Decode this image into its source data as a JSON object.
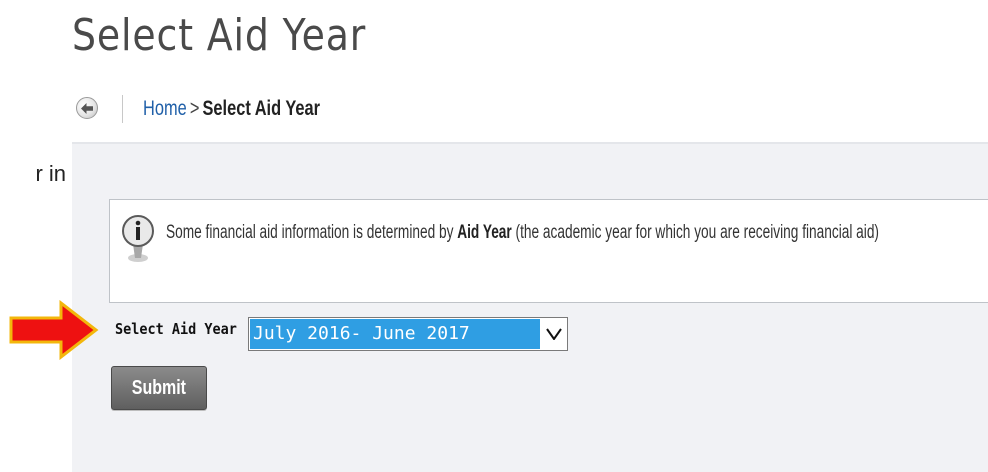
{
  "page": {
    "title": "Select Aid Year"
  },
  "breadcrumb": {
    "home": "Home",
    "separator": ">",
    "current": "Select Aid Year"
  },
  "left_fragment": "r in",
  "info": {
    "text_before": "Some financial aid information is determined by ",
    "text_bold": "Aid Year",
    "text_after": " (the academic year for which you are receiving financial aid)"
  },
  "form": {
    "select_label": "Select Aid Year",
    "selected_value": "July 2016- June 2017",
    "submit_label": "Submit"
  },
  "colors": {
    "arrow_fill": "#ee1111",
    "arrow_border": "#f3b70b",
    "select_highlight": "#2f9ee3",
    "link": "#1f5fa8"
  },
  "icons": [
    "back-arrow-icon",
    "info-icon",
    "dropdown-chevron-icon",
    "pointer-arrow-icon"
  ]
}
